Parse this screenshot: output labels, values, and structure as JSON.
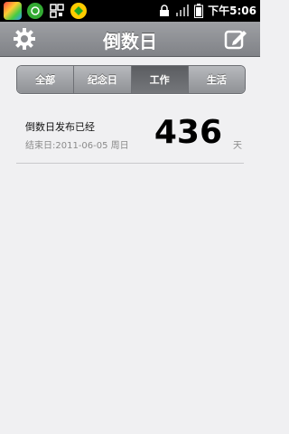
{
  "status_bar": {
    "time": "下午5:06",
    "icons": [
      "app-icon",
      "chat-icon",
      "qr-icon",
      "shield-icon",
      "lock-icon",
      "signal-icon",
      "battery-icon"
    ]
  },
  "header": {
    "title": "倒数日",
    "left_icon": "gear-icon",
    "right_icon": "edit-icon"
  },
  "tabs": [
    {
      "label": "全部",
      "active": false
    },
    {
      "label": "纪念日",
      "active": false
    },
    {
      "label": "工作",
      "active": true
    },
    {
      "label": "生活",
      "active": false
    }
  ],
  "list": [
    {
      "title": "倒数日发布已经",
      "subtitle": "结束日:2011-06-05 周日",
      "count": "436",
      "unit": "天"
    }
  ],
  "colors": {
    "background": "#f0f0f2",
    "titlebar": "#8f9196",
    "tab_active": "#66686c"
  }
}
